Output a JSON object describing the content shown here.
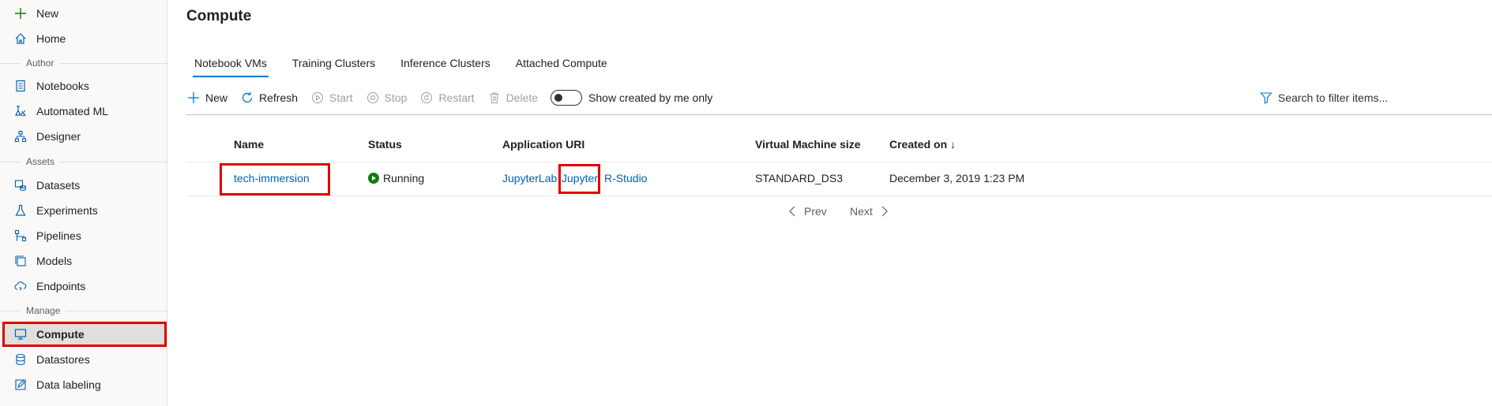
{
  "sidebar": {
    "new_label": "New",
    "home_label": "Home",
    "sections": {
      "author": "Author",
      "assets": "Assets",
      "manage": "Manage"
    },
    "author_items": [
      "Notebooks",
      "Automated ML",
      "Designer"
    ],
    "asset_items": [
      "Datasets",
      "Experiments",
      "Pipelines",
      "Models",
      "Endpoints"
    ],
    "manage_items": [
      "Compute",
      "Datastores",
      "Data labeling"
    ],
    "active_item": "Compute"
  },
  "page": {
    "title": "Compute"
  },
  "tabs": [
    "Notebook VMs",
    "Training Clusters",
    "Inference Clusters",
    "Attached Compute"
  ],
  "toolbar": {
    "new": "New",
    "refresh": "Refresh",
    "start": "Start",
    "stop": "Stop",
    "restart": "Restart",
    "delete": "Delete",
    "toggle_label": "Show created by me only"
  },
  "search": {
    "placeholder": "Search to filter items..."
  },
  "table": {
    "columns": [
      "Name",
      "Status",
      "Application URI",
      "Virtual Machine size",
      "Created on ↓"
    ],
    "rows": [
      {
        "name": "tech-immersion",
        "status": "Running",
        "uris": [
          "JupyterLab",
          "Jupyter",
          "R-Studio"
        ],
        "vm_size": "STANDARD_DS3",
        "created_on": "December 3, 2019 1:23 PM"
      }
    ]
  },
  "pager": {
    "prev": "Prev",
    "next": "Next"
  },
  "colors": {
    "accent": "#0078d4",
    "link": "#0063b1",
    "running": "#107c10",
    "highlight": "#e00000"
  }
}
